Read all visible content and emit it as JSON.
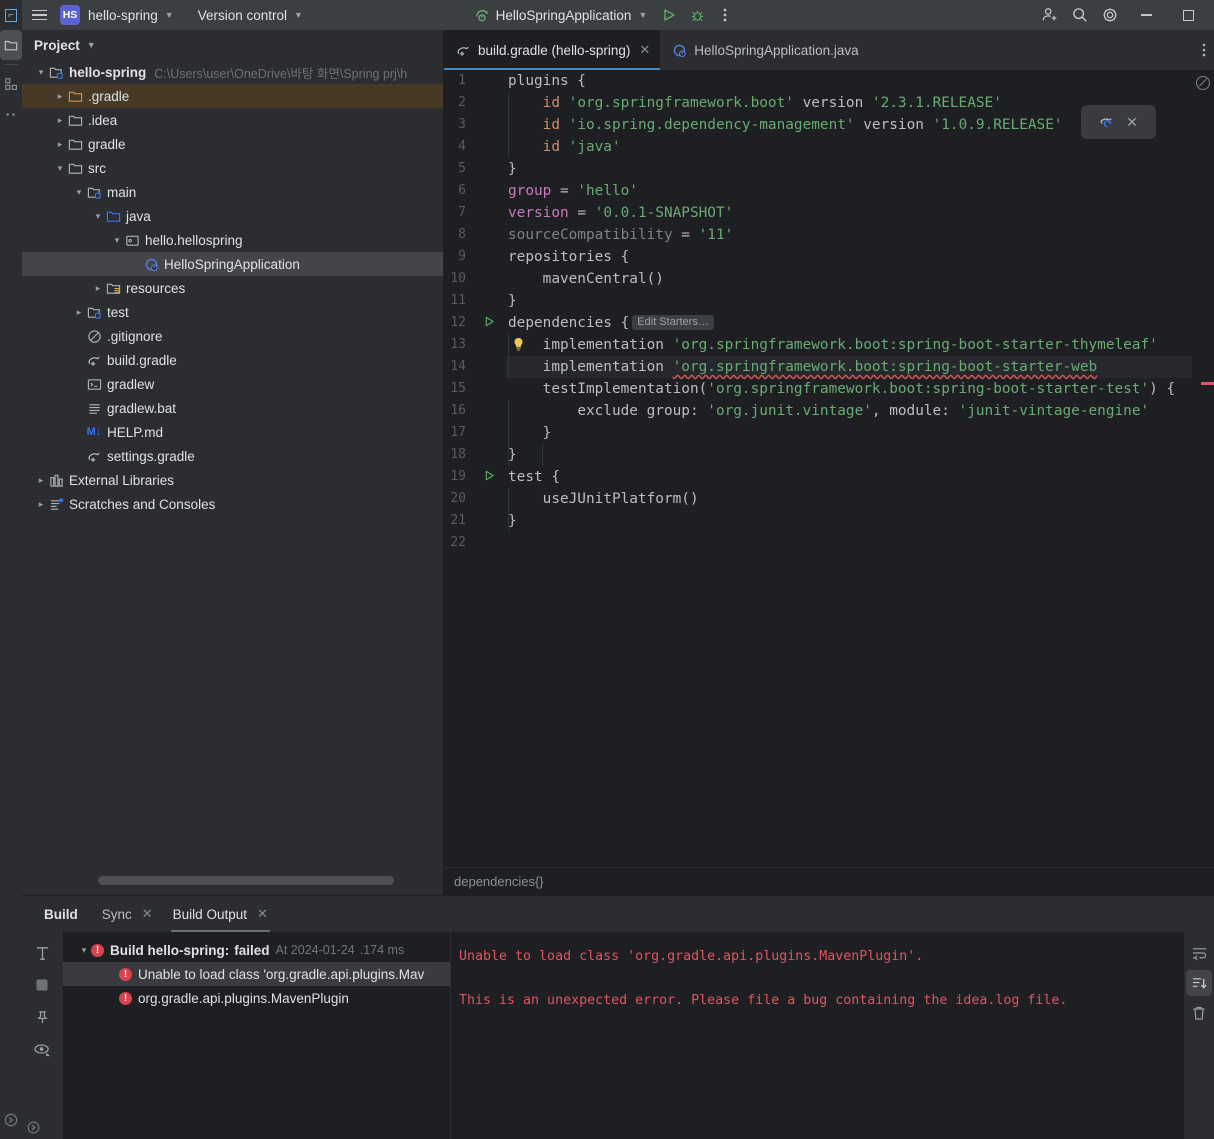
{
  "titlebar": {
    "menu_icon": "hamburger-icon",
    "project_badge": "HS",
    "project_name": "hello-spring",
    "vcs_label": "Version control",
    "run_config": "HelloSpringApplication",
    "run_icon": "run-icon",
    "debug_icon": "debug-icon",
    "more_icon": "more-vertical-icon",
    "add_user_icon": "add-user-icon",
    "search_icon": "search-icon",
    "settings_icon": "gear-icon",
    "minimize_icon": "minimize-icon",
    "maximize_icon": "maximize-icon"
  },
  "left_strip": {
    "project_icon": "project-folder-icon",
    "structure_icon": "structure-icon",
    "more_icon": "more-tool-windows-icon",
    "bottom_icon": "terminal-expand-icon"
  },
  "project_panel": {
    "header": "Project",
    "tree": [
      {
        "depth": 0,
        "arrow": "down",
        "icon": "module-icon",
        "label": "hello-spring",
        "bold": true,
        "path": "C:\\Users\\user\\OneDrive\\바탕 화면\\Spring prj\\h",
        "state": "none"
      },
      {
        "depth": 1,
        "arrow": "right",
        "icon": "folder-excluded-icon",
        "label": ".gradle",
        "bold": false,
        "path": "",
        "state": "highlight"
      },
      {
        "depth": 1,
        "arrow": "right",
        "icon": "folder-icon",
        "label": ".idea",
        "bold": false,
        "path": "",
        "state": "none"
      },
      {
        "depth": 1,
        "arrow": "right",
        "icon": "folder-icon",
        "label": "gradle",
        "bold": false,
        "path": "",
        "state": "none"
      },
      {
        "depth": 1,
        "arrow": "down",
        "icon": "folder-icon",
        "label": "src",
        "bold": false,
        "path": "",
        "state": "none"
      },
      {
        "depth": 2,
        "arrow": "down",
        "icon": "module-icon",
        "label": "main",
        "bold": false,
        "path": "",
        "state": "none"
      },
      {
        "depth": 3,
        "arrow": "down",
        "icon": "source-folder-icon",
        "label": "java",
        "bold": false,
        "path": "",
        "state": "none"
      },
      {
        "depth": 4,
        "arrow": "down",
        "icon": "package-icon",
        "label": "hello.hellospring",
        "bold": false,
        "path": "",
        "state": "none"
      },
      {
        "depth": 5,
        "arrow": "none",
        "icon": "spring-class-icon",
        "label": "HelloSpringApplication",
        "bold": false,
        "path": "",
        "state": "selected"
      },
      {
        "depth": 3,
        "arrow": "right",
        "icon": "resources-folder-icon",
        "label": "resources",
        "bold": false,
        "path": "",
        "state": "none"
      },
      {
        "depth": 2,
        "arrow": "right",
        "icon": "test-module-icon",
        "label": "test",
        "bold": false,
        "path": "",
        "state": "none"
      },
      {
        "depth": 2,
        "arrow": "none",
        "icon": "gitignore-icon",
        "label": ".gitignore",
        "bold": false,
        "path": "",
        "state": "none"
      },
      {
        "depth": 2,
        "arrow": "none",
        "icon": "gradle-file-icon",
        "label": "build.gradle",
        "bold": false,
        "path": "",
        "state": "none"
      },
      {
        "depth": 2,
        "arrow": "none",
        "icon": "shell-script-icon",
        "label": "gradlew",
        "bold": false,
        "path": "",
        "state": "none"
      },
      {
        "depth": 2,
        "arrow": "none",
        "icon": "text-file-icon",
        "label": "gradlew.bat",
        "bold": false,
        "path": "",
        "state": "none"
      },
      {
        "depth": 2,
        "arrow": "none",
        "icon": "markdown-icon",
        "label": "HELP.md",
        "bold": false,
        "path": "",
        "state": "none"
      },
      {
        "depth": 2,
        "arrow": "none",
        "icon": "gradle-file-icon",
        "label": "settings.gradle",
        "bold": false,
        "path": "",
        "state": "none"
      },
      {
        "depth": 0,
        "arrow": "right",
        "icon": "libraries-icon",
        "label": "External Libraries",
        "bold": false,
        "path": "",
        "state": "none"
      },
      {
        "depth": 0,
        "arrow": "right",
        "icon": "scratches-icon",
        "label": "Scratches and Consoles",
        "bold": false,
        "path": "",
        "state": "none"
      }
    ]
  },
  "editor": {
    "tabs": [
      {
        "icon": "gradle-file-icon",
        "label": "build.gradle (hello-spring)",
        "closable": true,
        "active": true
      },
      {
        "icon": "spring-class-icon",
        "label": "HelloSpringApplication.java",
        "closable": false,
        "active": false
      }
    ],
    "tab_more_icon": "more-vertical-icon",
    "gradle_popup": {
      "load_icon": "gradle-reload-icon",
      "close_icon": "close-icon"
    },
    "inspection_icon": "inspections-off-icon",
    "breadcrumb": "dependencies{}",
    "inlay_hint": "Edit Starters…",
    "lines": [
      {
        "n": 1,
        "run": false,
        "bulb": false,
        "current": false
      },
      {
        "n": 2,
        "run": false,
        "bulb": false,
        "current": false
      },
      {
        "n": 3,
        "run": false,
        "bulb": false,
        "current": false
      },
      {
        "n": 4,
        "run": false,
        "bulb": false,
        "current": false
      },
      {
        "n": 5,
        "run": false,
        "bulb": false,
        "current": false
      },
      {
        "n": 6,
        "run": false,
        "bulb": false,
        "current": false
      },
      {
        "n": 7,
        "run": false,
        "bulb": false,
        "current": false
      },
      {
        "n": 8,
        "run": false,
        "bulb": false,
        "current": false
      },
      {
        "n": 9,
        "run": false,
        "bulb": false,
        "current": false
      },
      {
        "n": 10,
        "run": false,
        "bulb": false,
        "current": false
      },
      {
        "n": 11,
        "run": false,
        "bulb": false,
        "current": false
      },
      {
        "n": 12,
        "run": true,
        "bulb": false,
        "current": false
      },
      {
        "n": 13,
        "run": false,
        "bulb": true,
        "current": false
      },
      {
        "n": 14,
        "run": false,
        "bulb": false,
        "current": true
      },
      {
        "n": 15,
        "run": false,
        "bulb": false,
        "current": false
      },
      {
        "n": 16,
        "run": false,
        "bulb": false,
        "current": false
      },
      {
        "n": 17,
        "run": false,
        "bulb": false,
        "current": false
      },
      {
        "n": 18,
        "run": false,
        "bulb": false,
        "current": false
      },
      {
        "n": 19,
        "run": true,
        "bulb": false,
        "current": false
      },
      {
        "n": 20,
        "run": false,
        "bulb": false,
        "current": false
      },
      {
        "n": 21,
        "run": false,
        "bulb": false,
        "current": false
      },
      {
        "n": 22,
        "run": false,
        "bulb": false,
        "current": false
      }
    ],
    "code_text": {
      "l1": "plugins {",
      "l2_id": "id",
      "l2_str": "'org.springframework.boot'",
      "l2_ver": "version",
      "l2_val": "'2.3.1.RELEASE'",
      "l3_id": "id",
      "l3_str": "'io.spring.dependency-management'",
      "l3_ver": "version",
      "l3_val": "'1.0.9.RELEASE'",
      "l4_id": "id",
      "l4_str": "'java'",
      "l5": "}",
      "l6_k": "group",
      "l6_eq": " = ",
      "l6_v": "'hello'",
      "l7_k": "version",
      "l7_eq": " = ",
      "l7_v": "'0.0.1-SNAPSHOT'",
      "l8_k": "sourceCompatibility",
      "l8_eq": " = ",
      "l8_v": "'11'",
      "l9": "repositories {",
      "l10": "mavenCentral()",
      "l11": "}",
      "l12": "dependencies {",
      "l13_k": "implementation",
      "l13_v": "'org.springframework.boot:spring-boot-starter-thymeleaf'",
      "l14_k": "implementation",
      "l14_v": "'org.springframework.boot:spring-boot-starter-web",
      "l15_k": "testImplementation(",
      "l15_v": "'org.springframework.boot:spring-boot-starter-test'",
      "l15_t": ") {",
      "l16_k": "exclude group: ",
      "l16_v1": "'org.junit.vintage'",
      "l16_m": ", module: ",
      "l16_v2": "'junit-vintage-engine'",
      "l17": "}",
      "l18": "}",
      "l19": "test {",
      "l20": "useJUnitPlatform()",
      "l21": "}"
    }
  },
  "build_panel": {
    "title": "Build",
    "tabs": [
      {
        "label": "Sync",
        "closable": true,
        "active": false
      },
      {
        "label": "Build Output",
        "closable": true,
        "active": true
      }
    ],
    "side_icons": [
      {
        "name": "build-hammer-icon",
        "selected": false
      },
      {
        "name": "stop-icon",
        "selected": false
      },
      {
        "name": "pin-icon",
        "selected": false
      },
      {
        "name": "eye-filter-icon",
        "selected": false
      }
    ],
    "tree": [
      {
        "depth": 0,
        "arrow": "down",
        "label": "Build hello-spring:",
        "status": "failed",
        "meta": "At 2024-01-24",
        "meta2": ".174 ms",
        "selected": false
      },
      {
        "depth": 1,
        "arrow": "none",
        "label": "Unable to load class 'org.gradle.api.plugins.Mav",
        "status": "",
        "meta": "",
        "meta2": "",
        "selected": true
      },
      {
        "depth": 1,
        "arrow": "none",
        "label": "org.gradle.api.plugins.MavenPlugin",
        "status": "",
        "meta": "",
        "meta2": "",
        "selected": false
      }
    ],
    "console": "Unable to load class 'org.gradle.api.plugins.MavenPlugin'.\n\nThis is an unexpected error. Please file a bug containing the idea.log file.",
    "right_icons": [
      {
        "name": "soft-wrap-icon",
        "selected": false
      },
      {
        "name": "scroll-to-end-icon",
        "selected": true
      },
      {
        "name": "trash-icon",
        "selected": false
      }
    ]
  },
  "colors": {
    "accent_blue": "#4a88c7",
    "error_red": "#e05561",
    "run_green": "#499c54",
    "string_green": "#6aab73",
    "keyword_orange": "#cf8e6d",
    "property_purple": "#c77dbb",
    "badge_purple": "#5a62d4"
  }
}
